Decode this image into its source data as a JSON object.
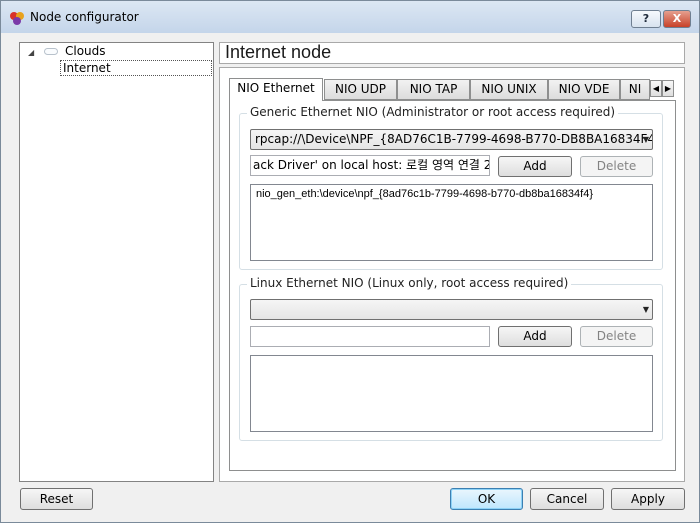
{
  "window": {
    "title": "Node configurator",
    "help_label": "?",
    "close_label": "X"
  },
  "tree": {
    "root_label": "Clouds",
    "child_label": "Internet"
  },
  "header": {
    "title": "Internet node"
  },
  "tabs": [
    {
      "label": "NIO Ethernet",
      "active": true
    },
    {
      "label": "NIO UDP"
    },
    {
      "label": "NIO TAP"
    },
    {
      "label": "NIO UNIX"
    },
    {
      "label": "NIO VDE"
    },
    {
      "label": "NI"
    }
  ],
  "generic_nio": {
    "title": "Generic Ethernet NIO (Administrator or root access required)",
    "selected_adapter": "rpcap://\\Device\\NPF_{8AD76C1B-7799-4698-B770-DB8BA16834F4",
    "description": "ack Driver' on local host: 로컬 영역 연결 2",
    "add_label": "Add",
    "delete_label": "Delete",
    "list_items": [
      "nio_gen_eth:\\device\\npf_{8ad76c1b-7799-4698-b770-db8ba16834f4}"
    ]
  },
  "linux_nio": {
    "title": "Linux Ethernet NIO (Linux only, root access required)",
    "selected_adapter": "",
    "input_value": "",
    "add_label": "Add",
    "delete_label": "Delete"
  },
  "footer": {
    "reset_label": "Reset",
    "ok_label": "OK",
    "cancel_label": "Cancel",
    "apply_label": "Apply"
  }
}
